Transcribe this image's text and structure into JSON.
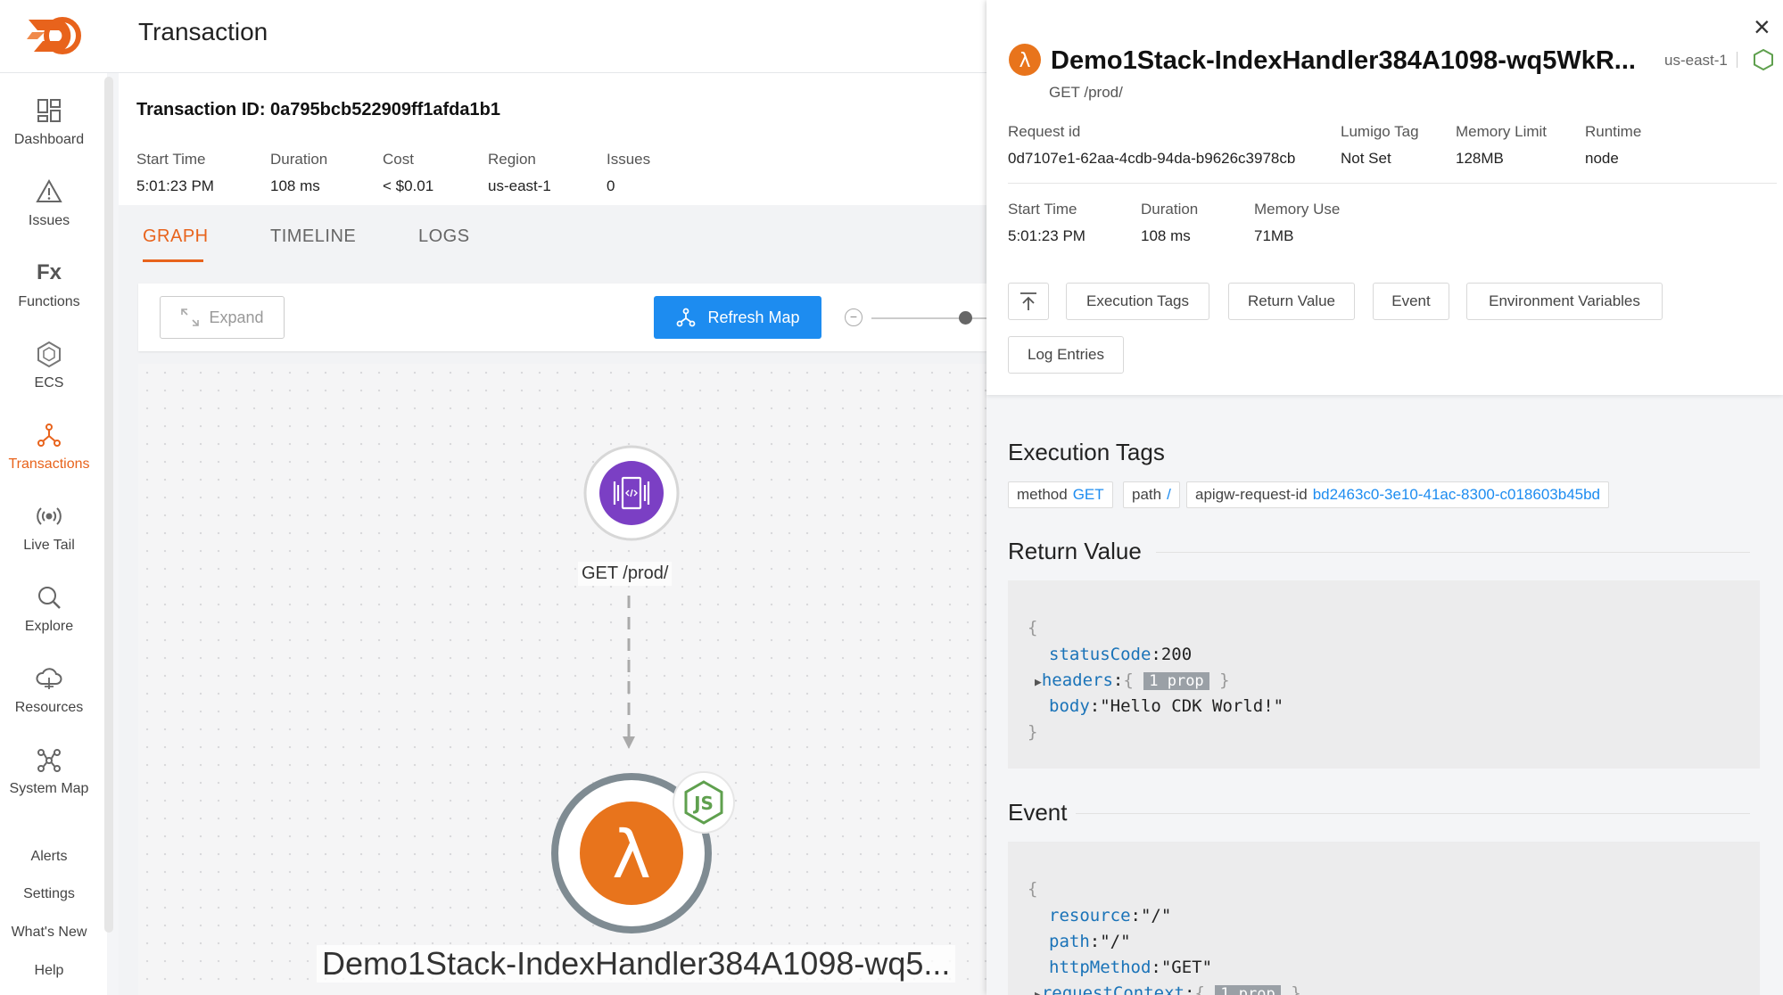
{
  "header": {
    "title": "Transaction"
  },
  "sidebar": {
    "items": [
      {
        "label": "Dashboard",
        "icon": "dashboard-icon"
      },
      {
        "label": "Issues",
        "icon": "warning-icon"
      },
      {
        "label": "Functions",
        "icon": "fx-icon"
      },
      {
        "label": "ECS",
        "icon": "ecs-icon"
      },
      {
        "label": "Transactions",
        "icon": "transactions-icon",
        "active": true
      },
      {
        "label": "Live Tail",
        "icon": "broadcast-icon"
      },
      {
        "label": "Explore",
        "icon": "search-icon"
      },
      {
        "label": "Resources",
        "icon": "cloud-icon"
      },
      {
        "label": "System Map",
        "icon": "system-map-icon"
      }
    ],
    "links": [
      "Alerts",
      "Settings",
      "What's New",
      "Help"
    ],
    "fx_glyph": "Fx"
  },
  "transaction": {
    "id_label": "Transaction ID: 0a795bcb522909ff1afda1b1",
    "meta": [
      {
        "key": "Start Time",
        "value": "5:01:23 PM"
      },
      {
        "key": "Duration",
        "value": "108 ms"
      },
      {
        "key": "Cost",
        "value": "< $0.01"
      },
      {
        "key": "Region",
        "value": "us-east-1"
      },
      {
        "key": "Issues",
        "value": "0"
      }
    ],
    "tabs": [
      "GRAPH",
      "TIMELINE",
      "LOGS"
    ],
    "active_tab": "GRAPH"
  },
  "graph": {
    "expand_label": "Expand",
    "refresh_label": "Refresh Map",
    "zoom_minus": "−",
    "api_node_label": "GET /prod/",
    "lambda_node_label": "Demo1Stack-IndexHandler384A1098-wq5...",
    "js_badge": "JS",
    "lambda_glyph": "λ"
  },
  "drawer": {
    "close": "×",
    "title": "Demo1Stack-IndexHandler384A1098-wq5WkR...",
    "region": "us-east-1",
    "subtitle": "GET /prod/",
    "lambda_glyph": "λ",
    "details_row1": [
      {
        "key": "Request id",
        "value": "0d7107e1-62aa-4cdb-94da-b9626c3978cb"
      },
      {
        "key": "Lumigo Tag",
        "value": "Not Set"
      },
      {
        "key": "Memory Limit",
        "value": "128MB"
      },
      {
        "key": "Runtime",
        "value": "node"
      }
    ],
    "details_row2": [
      {
        "key": "Start Time",
        "value": "5:01:23 PM"
      },
      {
        "key": "Duration",
        "value": "108 ms"
      },
      {
        "key": "Memory Use",
        "value": "71MB"
      }
    ],
    "section_buttons": [
      "Execution Tags",
      "Return Value",
      "Event",
      "Environment Variables",
      "Log Entries"
    ],
    "execution_tags": {
      "title": "Execution Tags",
      "tags": [
        {
          "key": "method",
          "value": "GET"
        },
        {
          "key": "path",
          "value": "/"
        },
        {
          "key": "apigw-request-id",
          "value": "bd2463c0-3e10-41ac-8300-c018603b45bd"
        }
      ]
    },
    "return_value": {
      "title": "Return Value",
      "open_brace": "{",
      "close_brace": "}",
      "status_key": "statusCode",
      "status_val": "200",
      "headers_key": "headers",
      "headers_badge": "1 prop",
      "body_key": "body",
      "body_val": "\"Hello CDK World!\""
    },
    "event": {
      "title": "Event",
      "open_brace": "{",
      "resource_key": "resource",
      "resource_val": "\"/\"",
      "path_key": "path",
      "path_val": "\"/\"",
      "method_key": "httpMethod",
      "method_val": "\"GET\"",
      "ctx_key": "requestContext",
      "ctx_badge": "1 prop"
    }
  },
  "colors": {
    "accent": "#e8631c",
    "primary": "#1d8cf0",
    "api_gateway": "#7b3fc4"
  }
}
